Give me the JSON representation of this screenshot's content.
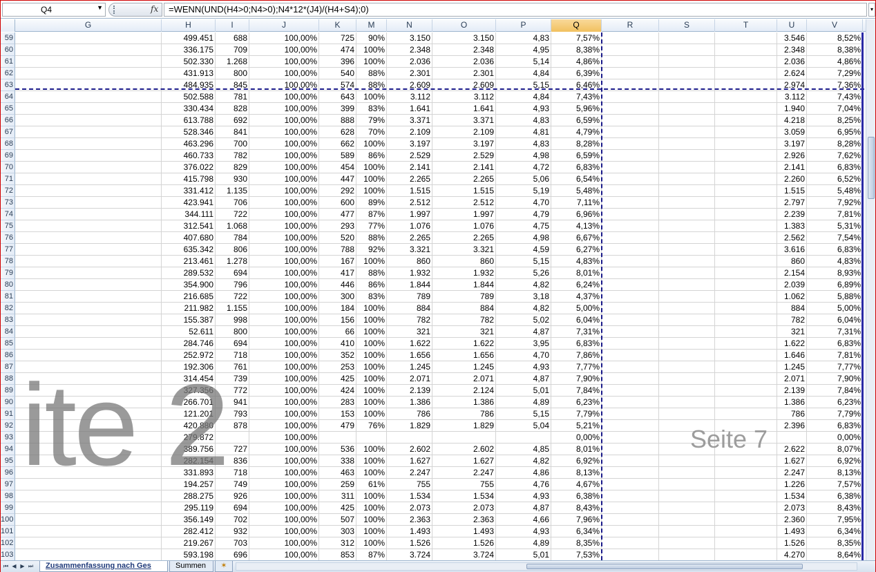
{
  "formula_bar": {
    "name_box": "Q4",
    "fx_label": "fx",
    "formula": "=WENN(UND(H4>0;N4>0);N4*12*(J4)/(H4+S4);0)"
  },
  "columns": [
    "G",
    "H",
    "I",
    "J",
    "K",
    "M",
    "N",
    "O",
    "P",
    "Q",
    "R",
    "S",
    "T",
    "U",
    "V"
  ],
  "active_column": "Q",
  "rows": [
    {
      "n": "59",
      "H": "499.451",
      "I": "688",
      "J": "100,00%",
      "K": "725",
      "M": "90%",
      "N": "3.150",
      "O": "3.150",
      "P": "4,83",
      "Q": "7,57%",
      "U": "3.546",
      "V": "8,52%"
    },
    {
      "n": "60",
      "H": "336.175",
      "I": "709",
      "J": "100,00%",
      "K": "474",
      "M": "100%",
      "N": "2.348",
      "O": "2.348",
      "P": "4,95",
      "Q": "8,38%",
      "U": "2.348",
      "V": "8,38%"
    },
    {
      "n": "61",
      "H": "502.330",
      "I": "1.268",
      "J": "100,00%",
      "K": "396",
      "M": "100%",
      "N": "2.036",
      "O": "2.036",
      "P": "5,14",
      "Q": "4,86%",
      "U": "2.036",
      "V": "4,86%"
    },
    {
      "n": "62",
      "H": "431.913",
      "I": "800",
      "J": "100,00%",
      "K": "540",
      "M": "88%",
      "N": "2.301",
      "O": "2.301",
      "P": "4,84",
      "Q": "6,39%",
      "U": "2.624",
      "V": "7,29%"
    },
    {
      "n": "63",
      "H": "484.935",
      "I": "845",
      "J": "100,00%",
      "K": "574",
      "M": "88%",
      "N": "2.609",
      "O": "2.609",
      "P": "5,15",
      "Q": "6,46%",
      "U": "2.974",
      "V": "7,36%"
    },
    {
      "n": "64",
      "H": "502.588",
      "I": "781",
      "J": "100,00%",
      "K": "643",
      "M": "100%",
      "N": "3.112",
      "O": "3.112",
      "P": "4,84",
      "Q": "7,43%",
      "U": "3.112",
      "V": "7,43%"
    },
    {
      "n": "65",
      "H": "330.434",
      "I": "828",
      "J": "100,00%",
      "K": "399",
      "M": "83%",
      "N": "1.641",
      "O": "1.641",
      "P": "4,93",
      "Q": "5,96%",
      "U": "1.940",
      "V": "7,04%"
    },
    {
      "n": "66",
      "H": "613.788",
      "I": "692",
      "J": "100,00%",
      "K": "888",
      "M": "79%",
      "N": "3.371",
      "O": "3.371",
      "P": "4,83",
      "Q": "6,59%",
      "U": "4.218",
      "V": "8,25%"
    },
    {
      "n": "67",
      "H": "528.346",
      "I": "841",
      "J": "100,00%",
      "K": "628",
      "M": "70%",
      "N": "2.109",
      "O": "2.109",
      "P": "4,81",
      "Q": "4,79%",
      "U": "3.059",
      "V": "6,95%"
    },
    {
      "n": "68",
      "H": "463.296",
      "I": "700",
      "J": "100,00%",
      "K": "662",
      "M": "100%",
      "N": "3.197",
      "O": "3.197",
      "P": "4,83",
      "Q": "8,28%",
      "U": "3.197",
      "V": "8,28%"
    },
    {
      "n": "69",
      "H": "460.733",
      "I": "782",
      "J": "100,00%",
      "K": "589",
      "M": "86%",
      "N": "2.529",
      "O": "2.529",
      "P": "4,98",
      "Q": "6,59%",
      "U": "2.926",
      "V": "7,62%"
    },
    {
      "n": "70",
      "H": "376.022",
      "I": "829",
      "J": "100,00%",
      "K": "454",
      "M": "100%",
      "N": "2.141",
      "O": "2.141",
      "P": "4,72",
      "Q": "6,83%",
      "U": "2.141",
      "V": "6,83%"
    },
    {
      "n": "71",
      "H": "415.798",
      "I": "930",
      "J": "100,00%",
      "K": "447",
      "M": "100%",
      "N": "2.265",
      "O": "2.265",
      "P": "5,06",
      "Q": "6,54%",
      "U": "2.260",
      "V": "6,52%"
    },
    {
      "n": "72",
      "H": "331.412",
      "I": "1.135",
      "J": "100,00%",
      "K": "292",
      "M": "100%",
      "N": "1.515",
      "O": "1.515",
      "P": "5,19",
      "Q": "5,48%",
      "U": "1.515",
      "V": "5,48%"
    },
    {
      "n": "73",
      "H": "423.941",
      "I": "706",
      "J": "100,00%",
      "K": "600",
      "M": "89%",
      "N": "2.512",
      "O": "2.512",
      "P": "4,70",
      "Q": "7,11%",
      "U": "2.797",
      "V": "7,92%"
    },
    {
      "n": "74",
      "H": "344.111",
      "I": "722",
      "J": "100,00%",
      "K": "477",
      "M": "87%",
      "N": "1.997",
      "O": "1.997",
      "P": "4,79",
      "Q": "6,96%",
      "U": "2.239",
      "V": "7,81%"
    },
    {
      "n": "75",
      "H": "312.541",
      "I": "1.068",
      "J": "100,00%",
      "K": "293",
      "M": "77%",
      "N": "1.076",
      "O": "1.076",
      "P": "4,75",
      "Q": "4,13%",
      "U": "1.383",
      "V": "5,31%"
    },
    {
      "n": "76",
      "H": "407.680",
      "I": "784",
      "J": "100,00%",
      "K": "520",
      "M": "88%",
      "N": "2.265",
      "O": "2.265",
      "P": "4,98",
      "Q": "6,67%",
      "U": "2.562",
      "V": "7,54%"
    },
    {
      "n": "77",
      "H": "635.342",
      "I": "806",
      "J": "100,00%",
      "K": "788",
      "M": "92%",
      "N": "3.321",
      "O": "3.321",
      "P": "4,59",
      "Q": "6,27%",
      "U": "3.616",
      "V": "6,83%"
    },
    {
      "n": "78",
      "H": "213.461",
      "I": "1.278",
      "J": "100,00%",
      "K": "167",
      "M": "100%",
      "N": "860",
      "O": "860",
      "P": "5,15",
      "Q": "4,83%",
      "U": "860",
      "V": "4,83%"
    },
    {
      "n": "79",
      "H": "289.532",
      "I": "694",
      "J": "100,00%",
      "K": "417",
      "M": "88%",
      "N": "1.932",
      "O": "1.932",
      "P": "5,26",
      "Q": "8,01%",
      "U": "2.154",
      "V": "8,93%"
    },
    {
      "n": "80",
      "H": "354.900",
      "I": "796",
      "J": "100,00%",
      "K": "446",
      "M": "86%",
      "N": "1.844",
      "O": "1.844",
      "P": "4,82",
      "Q": "6,24%",
      "U": "2.039",
      "V": "6,89%"
    },
    {
      "n": "81",
      "H": "216.685",
      "I": "722",
      "J": "100,00%",
      "K": "300",
      "M": "83%",
      "N": "789",
      "O": "789",
      "P": "3,18",
      "Q": "4,37%",
      "U": "1.062",
      "V": "5,88%"
    },
    {
      "n": "82",
      "H": "211.982",
      "I": "1.155",
      "J": "100,00%",
      "K": "184",
      "M": "100%",
      "N": "884",
      "O": "884",
      "P": "4,82",
      "Q": "5,00%",
      "U": "884",
      "V": "5,00%"
    },
    {
      "n": "83",
      "H": "155.387",
      "I": "998",
      "J": "100,00%",
      "K": "156",
      "M": "100%",
      "N": "782",
      "O": "782",
      "P": "5,02",
      "Q": "6,04%",
      "U": "782",
      "V": "6,04%"
    },
    {
      "n": "84",
      "H": "52.611",
      "I": "800",
      "J": "100,00%",
      "K": "66",
      "M": "100%",
      "N": "321",
      "O": "321",
      "P": "4,87",
      "Q": "7,31%",
      "U": "321",
      "V": "7,31%"
    },
    {
      "n": "85",
      "H": "284.746",
      "I": "694",
      "J": "100,00%",
      "K": "410",
      "M": "100%",
      "N": "1.622",
      "O": "1.622",
      "P": "3,95",
      "Q": "6,83%",
      "U": "1.622",
      "V": "6,83%"
    },
    {
      "n": "86",
      "H": "252.972",
      "I": "718",
      "J": "100,00%",
      "K": "352",
      "M": "100%",
      "N": "1.656",
      "O": "1.656",
      "P": "4,70",
      "Q": "7,86%",
      "U": "1.646",
      "V": "7,81%"
    },
    {
      "n": "87",
      "H": "192.306",
      "I": "761",
      "J": "100,00%",
      "K": "253",
      "M": "100%",
      "N": "1.245",
      "O": "1.245",
      "P": "4,93",
      "Q": "7,77%",
      "U": "1.245",
      "V": "7,77%"
    },
    {
      "n": "88",
      "H": "314.454",
      "I": "739",
      "J": "100,00%",
      "K": "425",
      "M": "100%",
      "N": "2.071",
      "O": "2.071",
      "P": "4,87",
      "Q": "7,90%",
      "U": "2.071",
      "V": "7,90%"
    },
    {
      "n": "89",
      "H": "327.356",
      "I": "772",
      "J": "100,00%",
      "K": "424",
      "M": "100%",
      "N": "2.139",
      "O": "2.124",
      "P": "5,01",
      "Q": "7,84%",
      "U": "2.139",
      "V": "7,84%"
    },
    {
      "n": "90",
      "H": "266.701",
      "I": "941",
      "J": "100,00%",
      "K": "283",
      "M": "100%",
      "N": "1.386",
      "O": "1.386",
      "P": "4,89",
      "Q": "6,23%",
      "U": "1.386",
      "V": "6,23%"
    },
    {
      "n": "91",
      "H": "121.201",
      "I": "793",
      "J": "100,00%",
      "K": "153",
      "M": "100%",
      "N": "786",
      "O": "786",
      "P": "5,15",
      "Q": "7,79%",
      "U": "786",
      "V": "7,79%"
    },
    {
      "n": "92",
      "H": "420.880",
      "I": "878",
      "J": "100,00%",
      "K": "479",
      "M": "76%",
      "N": "1.829",
      "O": "1.829",
      "P": "5,04",
      "Q": "5,21%",
      "U": "2.396",
      "V": "6,83%"
    },
    {
      "n": "93",
      "H": "279.872",
      "I": "",
      "J": "100,00%",
      "K": "",
      "M": "",
      "N": "",
      "O": "",
      "P": "",
      "Q": "0,00%",
      "U": "",
      "V": "0,00%"
    },
    {
      "n": "94",
      "H": "389.756",
      "I": "727",
      "J": "100,00%",
      "K": "536",
      "M": "100%",
      "N": "2.602",
      "O": "2.602",
      "P": "4,85",
      "Q": "8,01%",
      "U": "2.622",
      "V": "8,07%"
    },
    {
      "n": "95",
      "H": "282.154",
      "I": "836",
      "J": "100,00%",
      "K": "338",
      "M": "100%",
      "N": "1.627",
      "O": "1.627",
      "P": "4,82",
      "Q": "6,92%",
      "U": "1.627",
      "V": "6,92%"
    },
    {
      "n": "96",
      "H": "331.893",
      "I": "718",
      "J": "100,00%",
      "K": "463",
      "M": "100%",
      "N": "2.247",
      "O": "2.247",
      "P": "4,86",
      "Q": "8,13%",
      "U": "2.247",
      "V": "8,13%"
    },
    {
      "n": "97",
      "H": "194.257",
      "I": "749",
      "J": "100,00%",
      "K": "259",
      "M": "61%",
      "N": "755",
      "O": "755",
      "P": "4,76",
      "Q": "4,67%",
      "U": "1.226",
      "V": "7,57%"
    },
    {
      "n": "98",
      "H": "288.275",
      "I": "926",
      "J": "100,00%",
      "K": "311",
      "M": "100%",
      "N": "1.534",
      "O": "1.534",
      "P": "4,93",
      "Q": "6,38%",
      "U": "1.534",
      "V": "6,38%"
    },
    {
      "n": "99",
      "H": "295.119",
      "I": "694",
      "J": "100,00%",
      "K": "425",
      "M": "100%",
      "N": "2.073",
      "O": "2.073",
      "P": "4,87",
      "Q": "8,43%",
      "U": "2.073",
      "V": "8,43%"
    },
    {
      "n": "100",
      "H": "356.149",
      "I": "702",
      "J": "100,00%",
      "K": "507",
      "M": "100%",
      "N": "2.363",
      "O": "2.363",
      "P": "4,66",
      "Q": "7,96%",
      "U": "2.360",
      "V": "7,95%"
    },
    {
      "n": "101",
      "H": "282.412",
      "I": "932",
      "J": "100,00%",
      "K": "303",
      "M": "100%",
      "N": "1.493",
      "O": "1.493",
      "P": "4,93",
      "Q": "6,34%",
      "U": "1.493",
      "V": "6,34%"
    },
    {
      "n": "102",
      "H": "219.267",
      "I": "703",
      "J": "100,00%",
      "K": "312",
      "M": "100%",
      "N": "1.526",
      "O": "1.526",
      "P": "4,89",
      "Q": "8,35%",
      "U": "1.526",
      "V": "8,35%"
    },
    {
      "n": "103",
      "H": "593.198",
      "I": "696",
      "J": "100,00%",
      "K": "853",
      "M": "87%",
      "N": "3.724",
      "O": "3.724",
      "P": "5,01",
      "Q": "7,53%",
      "U": "4.270",
      "V": "8,64%"
    }
  ],
  "watermarks": {
    "left": "ite 2",
    "right": "Seite 7"
  },
  "sheet_tabs": [
    {
      "label": "Zusammenfassung nach Ges",
      "active": true
    },
    {
      "label": "Summen",
      "active": false
    }
  ],
  "new_sheet_icon": "insert-sheet-icon"
}
